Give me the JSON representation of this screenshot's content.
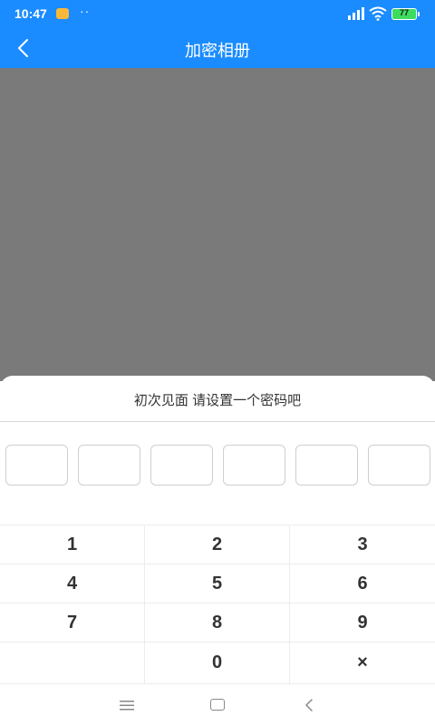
{
  "status_bar": {
    "time": "10:47",
    "dots": "··",
    "battery_level": "77"
  },
  "header": {
    "title": "加密相册"
  },
  "dialog": {
    "prompt": "初次见面 请设置一个密码吧",
    "pin_length": 6
  },
  "keypad": {
    "keys": [
      "1",
      "2",
      "3",
      "4",
      "5",
      "6",
      "7",
      "8",
      "9",
      "",
      "0",
      "×"
    ]
  },
  "colors": {
    "accent": "#1a8cff",
    "overlay": "#7a7a7a",
    "battery": "#3ddc5f"
  }
}
